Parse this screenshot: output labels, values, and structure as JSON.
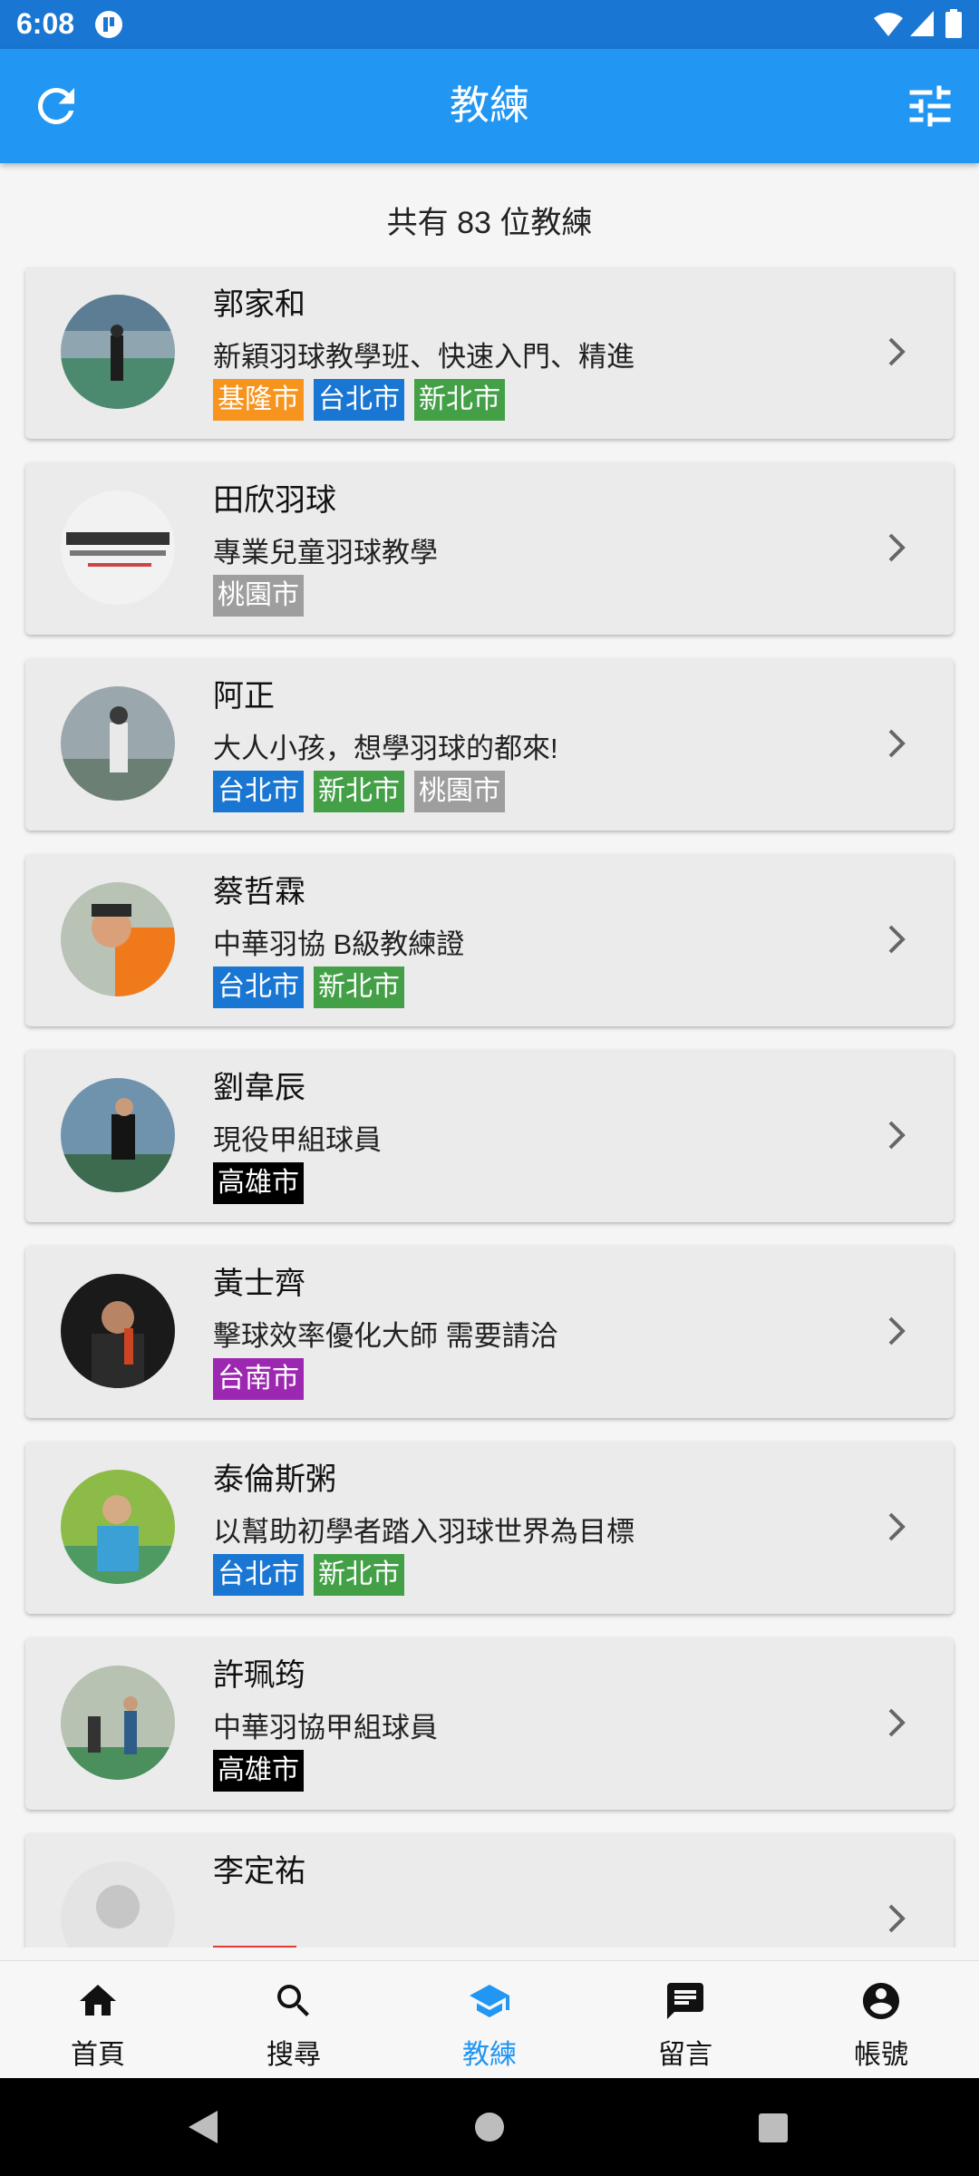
{
  "status_bar": {
    "time": "6:08"
  },
  "app_bar": {
    "title": "教練"
  },
  "summary": "共有 83 位教練",
  "colors": {
    "primary": "#2196f3",
    "基隆市": "#f7941d",
    "台北市": "#1976d2",
    "新北市": "#43a047",
    "桃園市": "#9e9e9e",
    "高雄市": "#000000",
    "台南市": "#9c27b0"
  },
  "coaches": [
    {
      "name": "郭家和",
      "desc": "新穎羽球教學班、快速入門、精進",
      "tags": [
        "基隆市",
        "台北市",
        "新北市"
      ]
    },
    {
      "name": "田欣羽球",
      "desc": "專業兒童羽球教學",
      "tags": [
        "桃園市"
      ]
    },
    {
      "name": "阿正",
      "desc": "大人小孩，想學羽球的都來!",
      "tags": [
        "台北市",
        "新北市",
        "桃園市"
      ]
    },
    {
      "name": "蔡哲霖",
      "desc": "中華羽協 B級教練證",
      "tags": [
        "台北市",
        "新北市"
      ]
    },
    {
      "name": "劉韋辰",
      "desc": "現役甲組球員",
      "tags": [
        "高雄市"
      ]
    },
    {
      "name": "黃士齊",
      "desc": "擊球效率優化大師 需要請洽",
      "tags": [
        "台南市"
      ]
    },
    {
      "name": "泰倫斯粥",
      "desc": "以幫助初學者踏入羽球世界為目標",
      "tags": [
        "台北市",
        "新北市"
      ]
    },
    {
      "name": "許珮筠",
      "desc": "中華羽協甲組球員",
      "tags": [
        "高雄市"
      ]
    },
    {
      "name": "李定祐",
      "desc": "",
      "tags": []
    }
  ],
  "bottom_nav": [
    {
      "label": "首頁",
      "icon": "home-icon",
      "active": false
    },
    {
      "label": "搜尋",
      "icon": "search-icon",
      "active": false
    },
    {
      "label": "教練",
      "icon": "school-icon",
      "active": true
    },
    {
      "label": "留言",
      "icon": "chat-icon",
      "active": false
    },
    {
      "label": "帳號",
      "icon": "account-circle-icon",
      "active": false
    }
  ],
  "system_nav": {
    "back": "back-icon",
    "home": "home-circle-icon",
    "recents": "recents-icon"
  }
}
